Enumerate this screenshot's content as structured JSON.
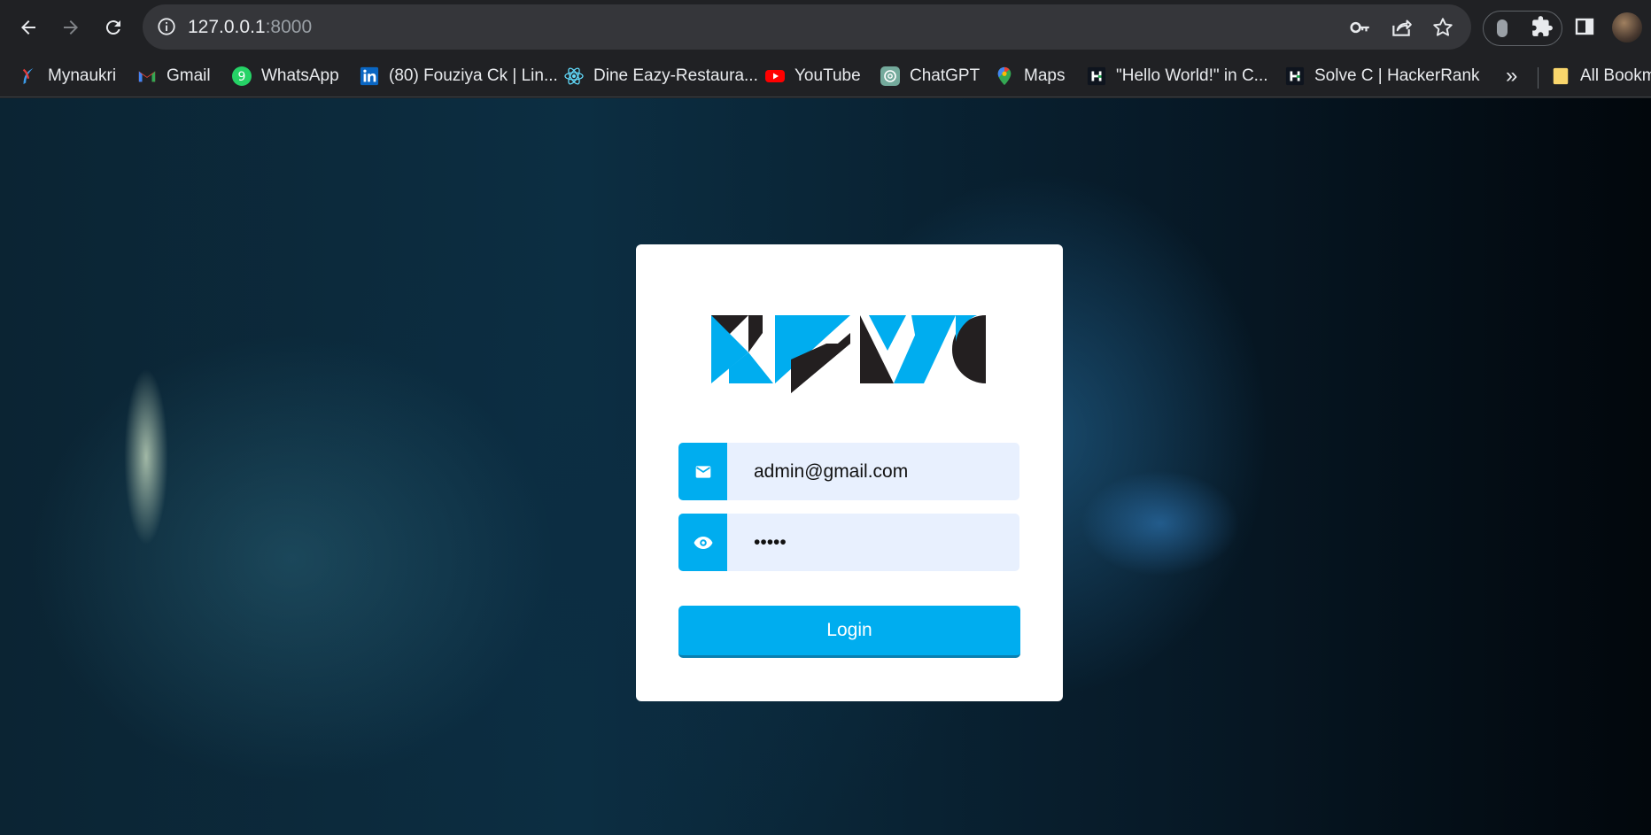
{
  "browser": {
    "url_host": "127.0.0.1",
    "url_port": ":8000",
    "bookmarks": [
      {
        "label": "Mynaukri",
        "icon": "mynaukri-icon"
      },
      {
        "label": "Gmail",
        "icon": "gmail-icon"
      },
      {
        "label": "WhatsApp",
        "icon": "whatsapp-icon"
      },
      {
        "label": "(80) Fouziya Ck | Lin...",
        "icon": "linkedin-icon"
      },
      {
        "label": "Dine Eazy-Restaura...",
        "icon": "react-icon"
      },
      {
        "label": "YouTube",
        "icon": "youtube-icon"
      },
      {
        "label": "ChatGPT",
        "icon": "chatgpt-icon"
      },
      {
        "label": "Maps",
        "icon": "maps-icon"
      },
      {
        "label": "\"Hello World!\" in C...",
        "icon": "hackerrank-icon"
      },
      {
        "label": "Solve C | HackerRank",
        "icon": "hackerrank-icon"
      }
    ],
    "more_label": "»",
    "all_bookmarks_label": "All Bookm"
  },
  "login": {
    "email_value": "admin@gmail.com",
    "password_value": "admin",
    "button_label": "Login"
  },
  "colors": {
    "accent": "#00adef",
    "input_bg": "#e8f0fe",
    "logo_dark": "#231f20"
  }
}
